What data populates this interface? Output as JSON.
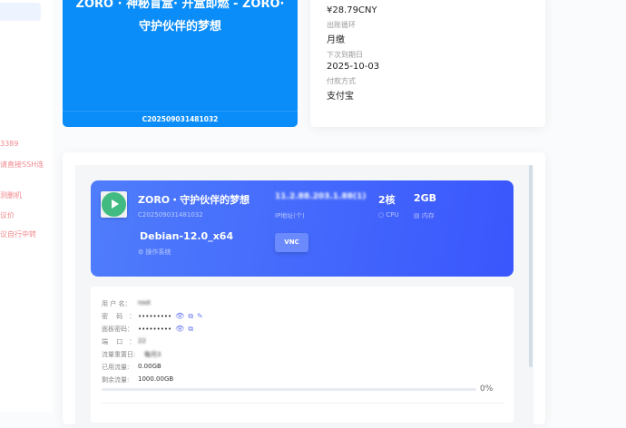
{
  "sidebar": {
    "notes": [
      "3389",
      "请直接SSH连",
      "测删机",
      "议价",
      "议自行中转"
    ]
  },
  "product": {
    "title": "ZORO · 神秘盲盒· 开盒即燃 - ZORO· 守护伙伴的梦想",
    "code": "C202509031481032"
  },
  "billing": {
    "amount": "¥28.79CNY",
    "cycle_label": "出账循环",
    "cycle": "月缴",
    "due_label": "下次到期日",
    "due": "2025-10-03",
    "pay_label": "付款方式",
    "pay": "支付宝"
  },
  "server": {
    "name": "ZORO・守护伙伴的梦想",
    "code": "C202509031481032",
    "os": "Debian-12.0_x64",
    "os_label": "操作系统",
    "ip": "11.2.88.203.1.88(1)",
    "ip_label": "IP地址(个)",
    "cpu": "2核",
    "cpu_label": "CPU",
    "mem": "2GB",
    "mem_label": "内存",
    "vnc": "VNC"
  },
  "details": {
    "username_label": "用 户 名：",
    "username": "root",
    "password_label": "密　 码　：",
    "password": "•••••••••",
    "panel_password_label": "面板密码：",
    "panel_password": "•••••••••",
    "port_label": "端　 口　：",
    "port": "22",
    "reset_label": "流量重置日:",
    "reset": "每月3",
    "used_label": "已用流量:",
    "used": "0.00GB",
    "remain_label": "剩余流量:",
    "remain": "1000.00GB",
    "usage_percent": "0%"
  },
  "colors": {
    "product": "#0a8cf9",
    "server_start": "#4f7dfb",
    "server_end": "#3a56fd",
    "play": "#41bb82"
  }
}
